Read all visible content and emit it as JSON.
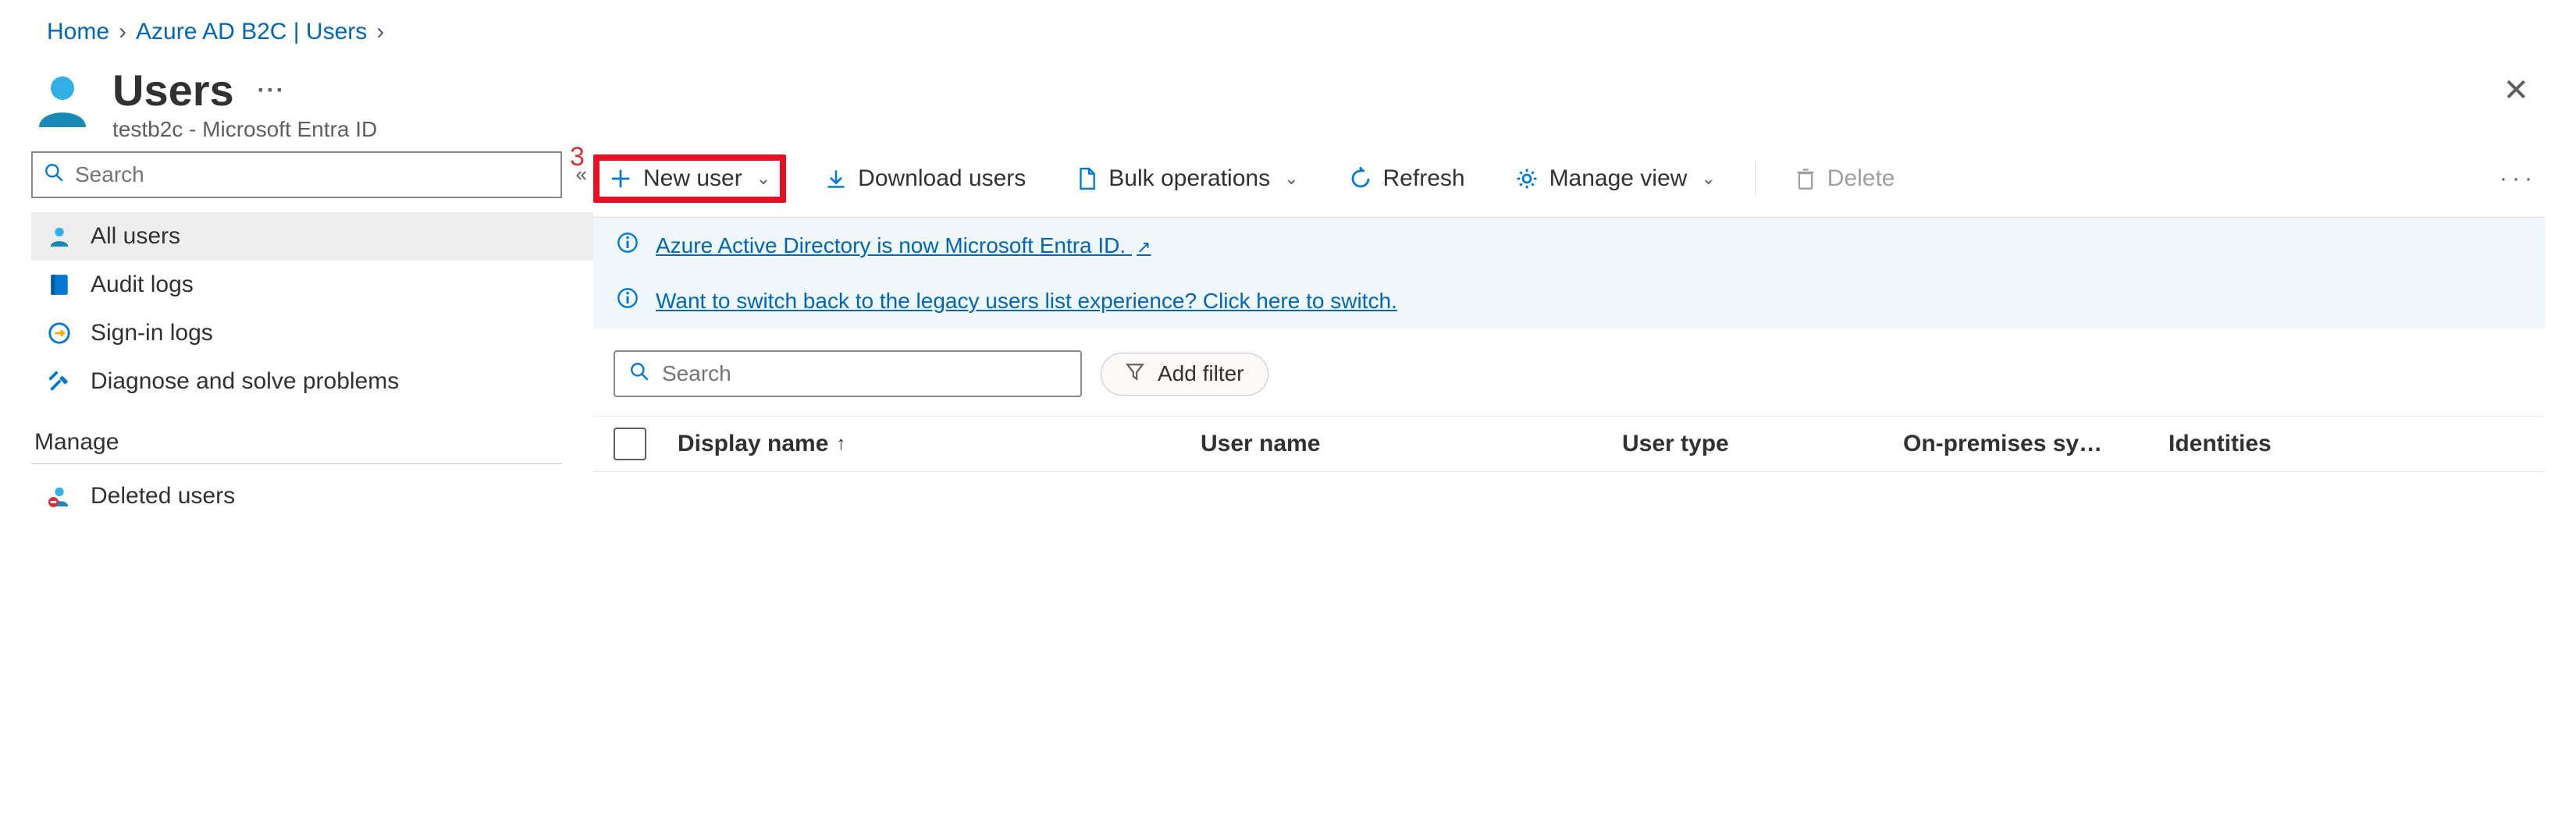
{
  "breadcrumb": {
    "items": [
      "Home",
      "Azure AD B2C | Users"
    ]
  },
  "header": {
    "title": "Users",
    "subtitle": "testb2c - Microsoft Entra ID"
  },
  "callout": {
    "number": "3"
  },
  "sidebar": {
    "search_placeholder": "Search",
    "items": [
      {
        "label": "All users",
        "selected": true
      },
      {
        "label": "Audit logs"
      },
      {
        "label": "Sign-in logs"
      },
      {
        "label": "Diagnose and solve problems"
      }
    ],
    "section_label": "Manage",
    "manage_items": [
      {
        "label": "Deleted users"
      }
    ]
  },
  "toolbar": {
    "new_user": "New user",
    "download_users": "Download users",
    "bulk_ops": "Bulk operations",
    "refresh": "Refresh",
    "manage_view": "Manage view",
    "delete": "Delete"
  },
  "banners": {
    "rename": "Azure Active Directory is now Microsoft Entra ID.",
    "legacy": "Want to switch back to the legacy users list experience? Click here to switch."
  },
  "filter": {
    "search_placeholder": "Search",
    "add_filter": "Add filter"
  },
  "table": {
    "columns": {
      "display_name": "Display name",
      "user_name": "User name",
      "user_type": "User type",
      "on_prem": "On-premises sy…",
      "identities": "Identities"
    },
    "rows": []
  }
}
